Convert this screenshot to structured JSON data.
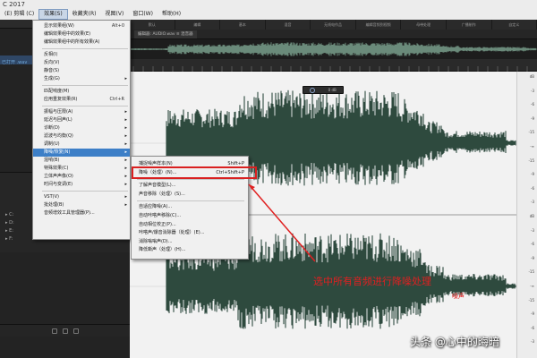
{
  "window": {
    "title": "C 2017"
  },
  "menubar": {
    "items": [
      "(E) 剪辑 (C)",
      "效果(S)",
      "收藏夹(R)",
      "视图(V)",
      "窗口(W)",
      "帮助(H)"
    ],
    "active_index": 1
  },
  "workspace_tabs": [
    "默认",
    "编辑",
    "基本",
    "混音",
    "无线电作品",
    "编辑音频到视频",
    "母带处理",
    "广播制作",
    "自定义"
  ],
  "editor_tab": {
    "label": "编辑器: AUDIO.wav ≡  混音器"
  },
  "left_panel": {
    "file_label": "已打开 .wav",
    "tree_rows": [
      "C:",
      "D:",
      "E:",
      "F:"
    ]
  },
  "hud": {
    "value": "0 dB"
  },
  "effects_menu": {
    "items": [
      {
        "label": "显示效果组(W)",
        "shortcut": "Alt+0"
      },
      {
        "label": "编辑效果组中的效果(E)",
        "shortcut": ""
      },
      {
        "label": "编辑效果组中的所有效果(A)",
        "shortcut": ""
      },
      {
        "sep": true
      },
      {
        "label": "反相(I)",
        "shortcut": ""
      },
      {
        "label": "反向(V)",
        "shortcut": ""
      },
      {
        "label": "静音(S)",
        "shortcut": ""
      },
      {
        "label": "生成(G)",
        "shortcut": "",
        "arrow": true
      },
      {
        "sep": true
      },
      {
        "label": "匹配响度(M)",
        "shortcut": ""
      },
      {
        "label": "应用重复效果(R)",
        "shortcut": "Ctrl+R"
      },
      {
        "sep": true
      },
      {
        "label": "振幅与压限(A)",
        "shortcut": "",
        "arrow": true
      },
      {
        "label": "延迟与回声(L)",
        "shortcut": "",
        "arrow": true
      },
      {
        "label": "诊断(D)",
        "shortcut": "",
        "arrow": true
      },
      {
        "label": "滤波与均衡(Q)",
        "shortcut": "",
        "arrow": true
      },
      {
        "label": "调制(U)",
        "shortcut": "",
        "arrow": true
      },
      {
        "label": "降噪/恢复(N)",
        "shortcut": "",
        "arrow": true,
        "highlight": true
      },
      {
        "label": "混响(B)",
        "shortcut": "",
        "arrow": true
      },
      {
        "label": "特殊效果(C)",
        "shortcut": "",
        "arrow": true
      },
      {
        "label": "立体声声像(O)",
        "shortcut": "",
        "arrow": true
      },
      {
        "label": "时间与变调(E)",
        "shortcut": "",
        "arrow": true
      },
      {
        "sep": true
      },
      {
        "label": "VST(V)",
        "shortcut": "",
        "arrow": true
      },
      {
        "label": "批处理(B)",
        "shortcut": "",
        "arrow": true
      },
      {
        "label": "音频增效工具管理器(P)...",
        "shortcut": ""
      }
    ]
  },
  "noise_submenu": {
    "items": [
      {
        "label": "捕捉噪声样本(N)",
        "shortcut": "Shift+P"
      },
      {
        "label": "降噪（处理）(N)...",
        "shortcut": "Ctrl+Shift+P",
        "highlight": true
      },
      {
        "sep": true
      },
      {
        "label": "了解声音模型(L)...",
        "shortcut": ""
      },
      {
        "label": "声音移除（处理）(S)...",
        "shortcut": ""
      },
      {
        "sep": true
      },
      {
        "label": "自适应降噪(A)...",
        "shortcut": ""
      },
      {
        "label": "自动咔嗒声移除(C)...",
        "shortcut": ""
      },
      {
        "label": "自动相位校正(P)...",
        "shortcut": ""
      },
      {
        "label": "咔嗒声/爆音消除器（处理）(E)...",
        "shortcut": ""
      },
      {
        "label": "消除嗡嗡声(D)...",
        "shortcut": ""
      },
      {
        "label": "降低嘶声（处理）(H)...",
        "shortcut": ""
      }
    ]
  },
  "annotation": {
    "text": "选中所有音频进行降噪处理",
    "small": "噪声"
  },
  "watermark": {
    "text": "头条 @心中的晦暗"
  },
  "colors": {
    "waveform": "#2f4a3f",
    "highlight_box": "#d92020",
    "menu_highlight": "#3d7fc7",
    "annotation": "#e02020"
  },
  "db_scale": [
    "dB",
    "-3",
    "-6",
    "-9",
    "-15",
    "-∞",
    "-15",
    "-9",
    "-6",
    "-3",
    "dB",
    "-3",
    "-6",
    "-9",
    "-15",
    "-∞",
    "-15",
    "-9",
    "-6",
    "-3"
  ]
}
